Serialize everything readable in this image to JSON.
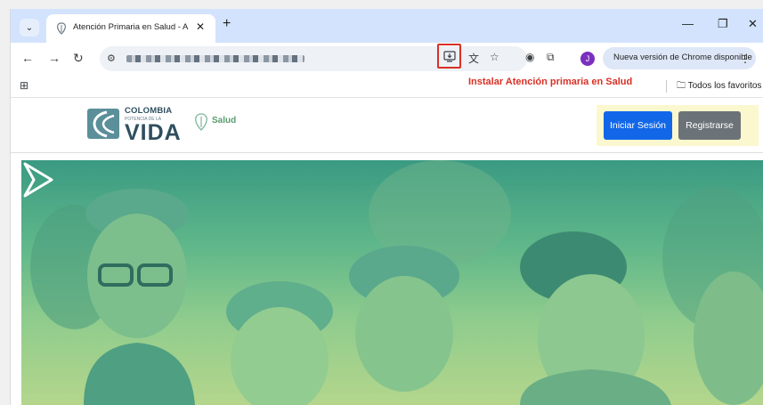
{
  "browser": {
    "tab_title": "Atención Primaria en Salud - A",
    "tab_search_icon": "chevron-down-icon",
    "new_tab_label": "+",
    "window_controls": {
      "minimize": "—",
      "restore": "❐",
      "close": "✕"
    },
    "toolbar_icons": [
      "back-icon",
      "forward-icon",
      "reload-icon",
      "site-info-icon",
      "install-app-icon",
      "translate-icon",
      "star-icon",
      "extension-circle-icon",
      "extensions-icon"
    ],
    "profile_initial": "J",
    "update_chip": "Nueva versión de Chrome disponible",
    "bookmarks": {
      "folder_label": "Todos los favoritos"
    }
  },
  "annotation": {
    "install_label": "Instalar Atención primaria en Salud",
    "highlight_color": "#d93025"
  },
  "site": {
    "logo": {
      "top": "COLOMBIA",
      "middle": "POTENCIA DE LA",
      "main": "VIDA",
      "salud": "Salud"
    },
    "login_button": "Iniciar Sesión",
    "register_button": "Registrarse",
    "colors": {
      "login": "#1167e8",
      "register": "#6c7378",
      "auth_bg": "#fbf8cf",
      "hero_top": "#3a9a82",
      "hero_bottom": "#b4d68c"
    }
  }
}
